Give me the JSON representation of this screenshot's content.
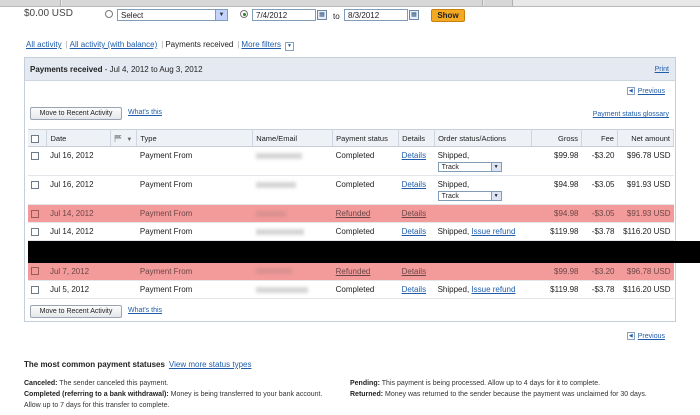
{
  "filter": {
    "amount_prefix": "$0.00 USD",
    "select_value": "Select",
    "date_from": "7/4/2012",
    "to_label": "to",
    "date_to": "8/3/2012",
    "show_button": "Show"
  },
  "view_tabs": {
    "all_activity": "All activity",
    "all_activity_balance": "All activity (with balance)",
    "payments_received": "Payments received",
    "more_filters": "More filters"
  },
  "panel": {
    "title": "Payments received",
    "range": " - Jul 4, 2012 to Aug 3, 2012",
    "print": "Print",
    "previous": "Previous",
    "move_button": "Move to Recent Activity",
    "whats_this": "What's this",
    "glossary": "Payment status glossary"
  },
  "table": {
    "headers": [
      "Date",
      "Type",
      "Name/Email",
      "Payment status",
      "Details",
      "Order status/Actions",
      "Gross",
      "Fee",
      "Net amount"
    ],
    "rows": [
      {
        "date": "Jul 16, 2012",
        "type": "Payment From",
        "status": "Completed",
        "details": "Details",
        "order_status": "Shipped,",
        "action": "Track",
        "gross": "$99.98",
        "fee": "-$3.20",
        "net": "$96.78 USD"
      },
      {
        "date": "Jul 16, 2012",
        "type": "Payment From",
        "status": "Completed",
        "details": "Details",
        "order_status": "Shipped,",
        "action": "Track",
        "gross": "$94.98",
        "fee": "-$3.05",
        "net": "$91.93 USD"
      },
      {
        "date": "Jul 14, 2012",
        "type": "Payment From",
        "status": "Refunded",
        "details": "Details",
        "order_status": "",
        "action": "",
        "gross": "$94.98",
        "fee": "-$3.05",
        "net": "$91.93 USD"
      },
      {
        "date": "Jul 14, 2012",
        "type": "Payment From",
        "status": "Completed",
        "details": "Details",
        "order_status": "Shipped,",
        "action": "Issue refund",
        "gross": "$119.98",
        "fee": "-$3.78",
        "net": "$116.20 USD"
      },
      {
        "date": "Jul 7, 2012",
        "type": "Payment From",
        "status": "Refunded",
        "details": "Details",
        "order_status": "",
        "action": "",
        "gross": "$99.98",
        "fee": "-$3.20",
        "net": "$96.78 USD"
      },
      {
        "date": "Jul 5, 2012",
        "type": "Payment From",
        "status": "Completed",
        "details": "Details",
        "order_status": "Shipped,",
        "action": "Issue refund",
        "gross": "$119.98",
        "fee": "-$3.78",
        "net": "$116.20 USD"
      }
    ]
  },
  "statuses": {
    "title": "The most common payment statuses",
    "view_more": "View more status types",
    "canceled_label": "Canceled:",
    "canceled_text": " The sender canceled this payment.",
    "completed_label": "Completed (referring to a bank withdrawal):",
    "completed_text": " Money is being transferred to your bank account. Allow up to 7 days for this transfer to complete.",
    "pending_label": "Pending:",
    "pending_text": " This payment is being processed. Allow up to 4 days for it to complete.",
    "returned_label": "Returned:",
    "returned_text": " Money was returned to the sender because the payment was unclaimed for 30 days."
  },
  "colors": {
    "refunded_row": "#f39a9a",
    "show_button": "#f3a922",
    "link": "#1f5dab"
  }
}
